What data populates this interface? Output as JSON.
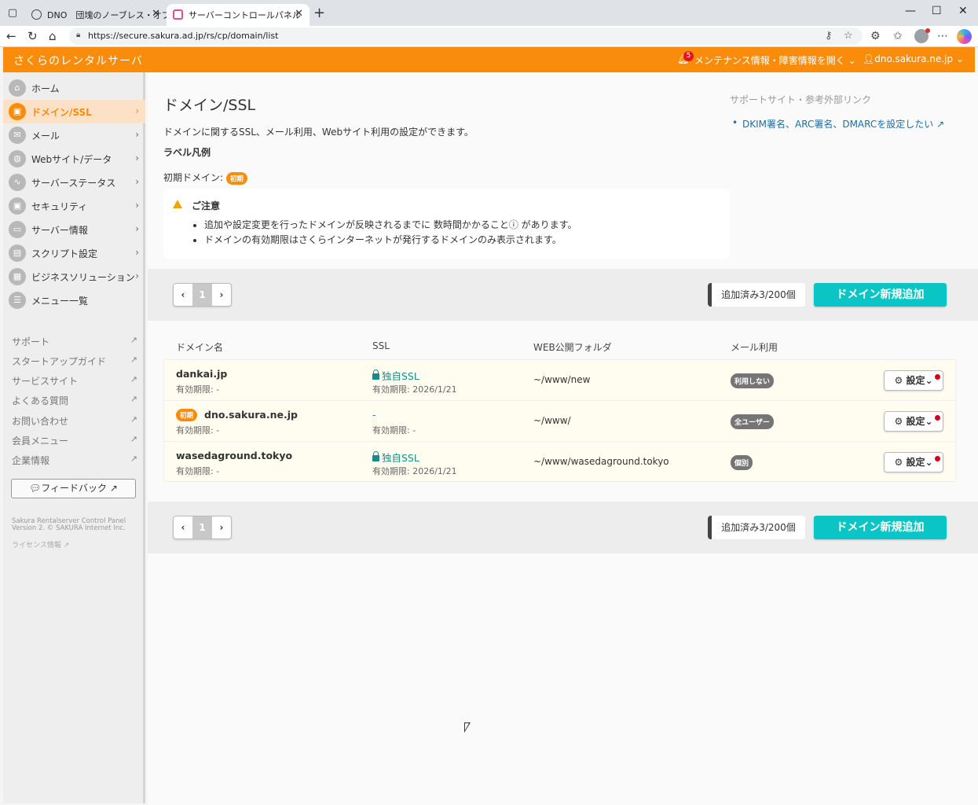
{
  "browser": {
    "tabs": [
      {
        "label": "DNO　団塊のノーブレス・オブリージュ"
      },
      {
        "label": "サーバーコントロールパネル"
      }
    ],
    "url": "https://secure.sakura.ad.jp/rs/cp/domain/list"
  },
  "header": {
    "brand": "さくらのレンタルサーバ",
    "notification_count": "5",
    "maintenance_label": "メンテナンス情報・障害情報を開く",
    "user": "dno.sakura.ne.jp"
  },
  "sidebar": {
    "items": [
      {
        "label": "ホーム",
        "icon": "home-icon"
      },
      {
        "label": "ドメイン/SSL",
        "icon": "lock-icon"
      },
      {
        "label": "メール",
        "icon": "mail-icon"
      },
      {
        "label": "Webサイト/データ",
        "icon": "globe-icon"
      },
      {
        "label": "サーバーステータス",
        "icon": "chart-icon"
      },
      {
        "label": "セキュリティ",
        "icon": "shield-icon"
      },
      {
        "label": "サーバー情報",
        "icon": "server-icon"
      },
      {
        "label": "スクリプト設定",
        "icon": "script-icon"
      },
      {
        "label": "ビジネスソリューション",
        "icon": "business-icon"
      },
      {
        "label": "メニュー一覧",
        "icon": "list-icon"
      }
    ],
    "links": [
      "サポート",
      "スタートアップガイド",
      "サービスサイト",
      "よくある質問",
      "お問い合わせ",
      "会員メニュー",
      "企業情報"
    ],
    "feedback": "フィードバック",
    "footer_line1": "Sakura Rentalserver Control Panel",
    "footer_line2": "Version 2. © SAKURA Internet Inc.",
    "license": "ライセンス情報"
  },
  "main": {
    "title": "ドメイン/SSL",
    "description": "ドメインに関するSSL、メール利用、Webサイト利用の設定ができます。",
    "legend_title": "ラベル凡例",
    "legend_initial_label": "初期ドメイン:",
    "initial_badge": "初期",
    "support_title": "サポートサイト・参考外部リンク",
    "support_link": "DKIM署名、ARC署名、DMARCを設定したい",
    "notice": {
      "title": "ご注意",
      "items": [
        "追加や設定変更を行ったドメインが反映されるまでに 数時間かかること",
        "があります。",
        "ドメインの有効期限はさくらインターネットが発行するドメインのみ表示されます。"
      ]
    },
    "pager": {
      "current": "1"
    },
    "count": "追加済み3/200個",
    "add_button": "ドメイン新規追加",
    "columns": [
      "ドメイン名",
      "SSL",
      "WEB公開フォルダ",
      "メール利用"
    ],
    "rows": [
      {
        "domain": "dankai.jp",
        "expiry": "有効期限: -",
        "ssl": "独自SSL",
        "ssl_expiry": "有効期限: 2026/1/21",
        "folder": "~/www/new",
        "mail": "利用しない",
        "setting": "設定"
      },
      {
        "domain": "dno.sakura.ne.jp",
        "expiry": "有効期限: -",
        "ssl": "-",
        "ssl_expiry": "有効期限: -",
        "folder": "~/www/",
        "mail": "全ユーザー",
        "setting": "設定"
      },
      {
        "domain": "wasedaground.tokyo",
        "expiry": "有効期限: -",
        "ssl": "独自SSL",
        "ssl_expiry": "有効期限: 2026/1/21",
        "folder": "~/www/wasedaground.tokyo",
        "mail": "個別",
        "setting": "設定"
      }
    ]
  },
  "colors": {
    "accent": "#f98c0a",
    "primary_button": "#0bc4c4",
    "link": "#1b6ea6"
  }
}
